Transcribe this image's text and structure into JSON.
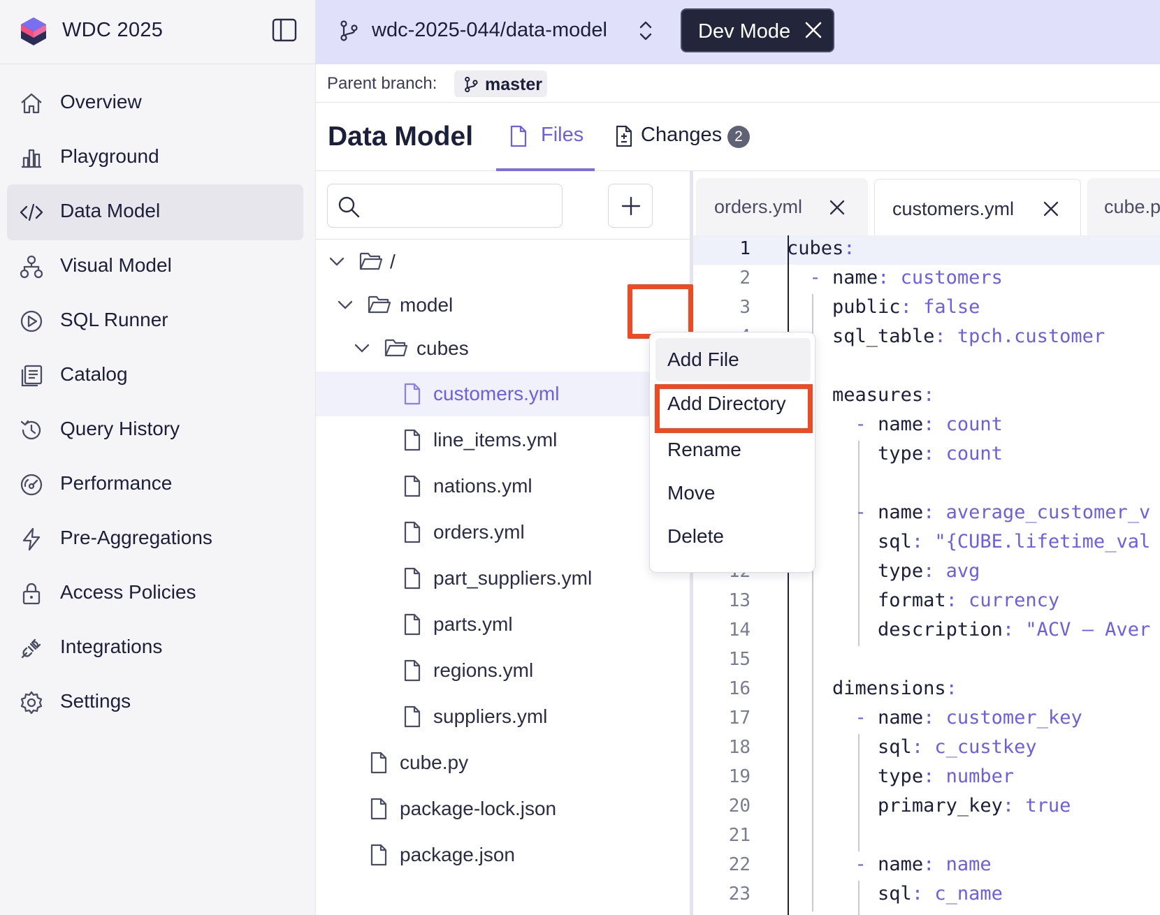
{
  "app": {
    "title": "WDC 2025"
  },
  "sidebar": {
    "items": [
      {
        "label": "Overview",
        "icon": "home-icon",
        "active": false
      },
      {
        "label": "Playground",
        "icon": "chart-bars-icon",
        "active": false
      },
      {
        "label": "Data Model",
        "icon": "code-icon",
        "active": true
      },
      {
        "label": "Visual Model",
        "icon": "hierarchy-icon",
        "active": false
      },
      {
        "label": "SQL Runner",
        "icon": "play-circle-icon",
        "active": false
      },
      {
        "label": "Catalog",
        "icon": "catalog-icon",
        "active": false
      },
      {
        "label": "Query History",
        "icon": "history-icon",
        "active": false
      },
      {
        "label": "Performance",
        "icon": "gauge-icon",
        "active": false
      },
      {
        "label": "Pre-Aggregations",
        "icon": "lightning-icon",
        "active": false
      },
      {
        "label": "Access Policies",
        "icon": "lock-icon",
        "active": false
      },
      {
        "label": "Integrations",
        "icon": "plug-icon",
        "active": false
      },
      {
        "label": "Settings",
        "icon": "gear-icon",
        "active": false
      }
    ]
  },
  "topbar": {
    "branch": "wdc-2025-044/data-model",
    "dev_mode_label": "Dev Mode"
  },
  "parent_branch": {
    "label": "Parent branch:",
    "name": "master"
  },
  "header": {
    "title": "Data Model",
    "tabs": [
      {
        "label": "Files",
        "active": true
      },
      {
        "label": "Changes",
        "badge": "2",
        "active": false
      }
    ]
  },
  "search": {
    "placeholder": "",
    "value": ""
  },
  "tree": [
    {
      "label": "/",
      "type": "folder",
      "expanded": true
    },
    {
      "label": "model",
      "type": "folder",
      "expanded": true
    },
    {
      "label": "cubes",
      "type": "folder",
      "expanded": true
    },
    {
      "label": "customers.yml",
      "type": "file",
      "selected": true
    },
    {
      "label": "line_items.yml",
      "type": "file"
    },
    {
      "label": "nations.yml",
      "type": "file"
    },
    {
      "label": "orders.yml",
      "type": "file"
    },
    {
      "label": "part_suppliers.yml",
      "type": "file"
    },
    {
      "label": "parts.yml",
      "type": "file"
    },
    {
      "label": "regions.yml",
      "type": "file"
    },
    {
      "label": "suppliers.yml",
      "type": "file"
    },
    {
      "label": "cube.py",
      "type": "file"
    },
    {
      "label": "package-lock.json",
      "type": "file"
    },
    {
      "label": "package.json",
      "type": "file"
    }
  ],
  "context_menu": {
    "items": [
      "Add File",
      "Add Directory",
      "Rename",
      "Move",
      "Delete"
    ],
    "highlighted": "Add Directory"
  },
  "editor": {
    "tabs": [
      "orders.yml",
      "customers.yml",
      "cube.py"
    ],
    "active_tab": "customers.yml",
    "line_numbers": [
      "1",
      "2",
      "3",
      "4",
      "12",
      "13",
      "14",
      "15",
      "16",
      "17",
      "18",
      "19",
      "20",
      "21",
      "22",
      "23"
    ],
    "current_line": "1",
    "code": {
      "l1_key": "cubes",
      "l2_key": "name",
      "l2_val": "customers",
      "l3_key": "public",
      "l3_val": "false",
      "l4_key": "sql_table",
      "l4_val": "tpch.customer",
      "l6_key": "measures",
      "l7_key": "name",
      "l7_val": "count",
      "l8_key": "type",
      "l8_val": "count",
      "l10_key": "name",
      "l10_val": "average_customer_v",
      "l11_key": "sql",
      "l11_val": "\"{CUBE.lifetime_val",
      "l12_key": "type",
      "l12_val": "avg",
      "l13_key": "format",
      "l13_val": "currency",
      "l14_key": "description",
      "l14_val": "\"ACV – Aver",
      "l16_key": "dimensions",
      "l17_key": "name",
      "l17_val": "customer_key",
      "l18_key": "sql",
      "l18_val": "c_custkey",
      "l19_key": "type",
      "l19_val": "number",
      "l20_key": "primary_key",
      "l20_val": "true",
      "l22_key": "name",
      "l22_val": "name",
      "l23_key": "sql",
      "l23_val": "c_name"
    }
  },
  "colors": {
    "accent": "#6b5ee8",
    "highlight_border": "#f04a23",
    "topbar_bg": "#e0e0fb",
    "dev_mode_bg": "#23263b"
  }
}
